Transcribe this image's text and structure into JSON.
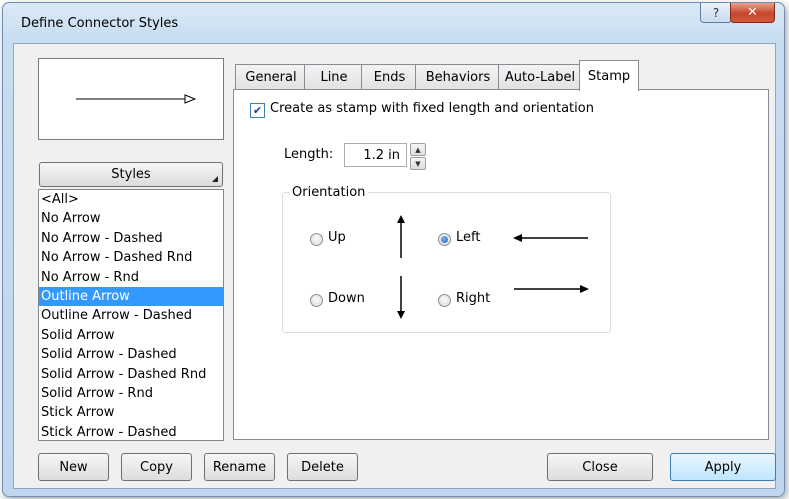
{
  "window": {
    "title": "Define Connector Styles",
    "help_label": "?",
    "close_label": "✕"
  },
  "left": {
    "styles_button": "Styles",
    "styles_list": [
      "<All>",
      "No Arrow",
      "No Arrow - Dashed",
      "No Arrow - Dashed Rnd",
      "No Arrow - Rnd",
      "Outline Arrow",
      "Outline Arrow - Dashed",
      "Solid Arrow",
      "Solid Arrow - Dashed",
      "Solid Arrow - Dashed Rnd",
      "Solid Arrow - Rnd",
      "Stick Arrow",
      "Stick Arrow - Dashed"
    ],
    "selected_index": 5
  },
  "tabs": [
    "General",
    "Line",
    "Ends",
    "Behaviors",
    "Auto-Label",
    "Stamp"
  ],
  "active_tab": "Stamp",
  "stamp": {
    "checkbox_label": "Create as stamp with fixed length and orientation",
    "checkbox_checked": true,
    "length_label": "Length:",
    "length_value": "1.2 in",
    "orientation_legend": "Orientation",
    "up_label": "Up",
    "left_label": "Left",
    "down_label": "Down",
    "right_label": "Right",
    "selected_orientation": "Left"
  },
  "buttons": {
    "new": "New",
    "copy": "Copy",
    "rename": "Rename",
    "delete": "Delete",
    "close": "Close",
    "apply": "Apply"
  },
  "colors": {
    "selection": "#3399ff",
    "title_bar": "#c6dcf1",
    "close_button": "#c6462c"
  }
}
